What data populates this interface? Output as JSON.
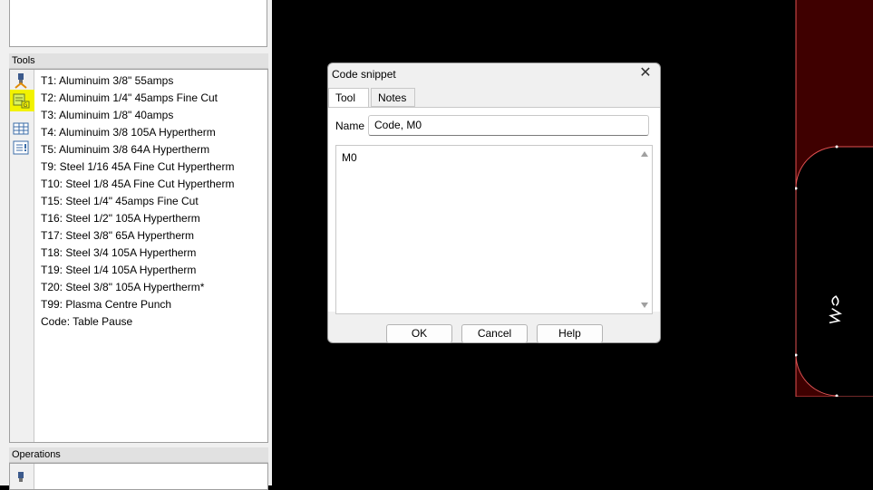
{
  "tools_panel": {
    "header": "Tools",
    "items": [
      "T1: Aluminuim 3/8\" 55amps",
      "T2: Aluminuim 1/4\" 45amps Fine Cut",
      "T3: Aluminuim 1/8\" 40amps",
      "T4: Aluminuim 3/8 105A  Hypertherm",
      "T5: Aluminuim 3/8 64A  Hypertherm",
      "T9: Steel 1/16 45A Fine Cut Hypertherm",
      "T10: Steel 1/8 45A Fine Cut Hypertherm",
      "T15: Steel 1/4\" 45amps Fine Cut",
      "T16: Steel 1/2\" 105A Hypertherm",
      "T17: Steel 3/8\" 65A Hypertherm",
      "T18: Steel 3/4 105A  Hypertherm",
      "T19: Steel 1/4 105A  Hypertherm",
      "T20: Steel 3/8\" 105A Hypertherm*",
      "T99: Plasma Centre Punch",
      "Code: Table Pause"
    ]
  },
  "operations_panel": {
    "header": "Operations"
  },
  "dialog": {
    "title": "Code snippet",
    "tabs": [
      "Tool",
      "Notes"
    ],
    "name_label": "Name",
    "name_value": "Code, M0",
    "code_text": "M0",
    "buttons": {
      "ok": "OK",
      "cancel": "Cancel",
      "help": "Help"
    }
  },
  "colors": {
    "canvas": "#000000",
    "part_fill": "#3f0000",
    "part_outline": "#e05050",
    "highlight": "#f2f200"
  },
  "icons": [
    "torch-icon",
    "gcode-icon",
    "table-icon",
    "list-icon",
    "close-icon",
    "scroll-up-icon",
    "scroll-down-icon"
  ]
}
